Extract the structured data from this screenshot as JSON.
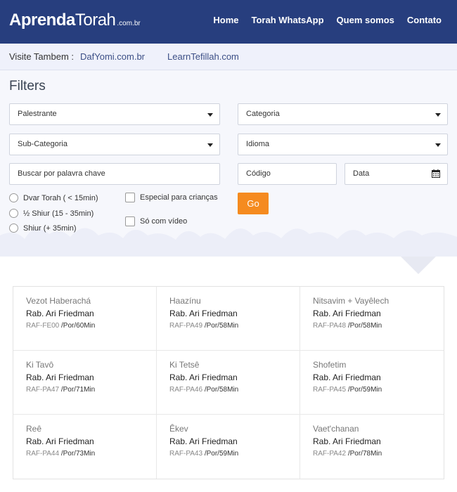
{
  "header": {
    "logo_aprenda": "Aprenda",
    "logo_torah": "Torah",
    "logo_domain": ".com.br",
    "nav": [
      "Home",
      "Torah WhatsApp",
      "Quem somos",
      "Contato"
    ]
  },
  "visit": {
    "label": "Visite Tambem :",
    "links": [
      "DafYomi.com.br",
      "LearnTefillah.com"
    ]
  },
  "filters": {
    "title": "Filters",
    "palestrante": "Palestrante",
    "categoria": "Categoria",
    "subcategoria": "Sub-Categoria",
    "idioma": "Idioma",
    "buscar_placeholder": "Buscar por palavra chave",
    "codigo_placeholder": "Código",
    "data_placeholder": "Data",
    "radios": [
      "Dvar Torah ( < 15min)",
      "½ Shiur (15 - 35min)",
      "Shiur (+ 35min)"
    ],
    "checks": [
      "Especial para crianças",
      "Só com vídeo"
    ],
    "go": "Go"
  },
  "results": [
    {
      "title": "Vezot Haberachá",
      "author": "Rab. Ari Friedman",
      "code": "RAF-FE00",
      "meta": " /Por/60Min"
    },
    {
      "title": "Haazínu",
      "author": "Rab. Ari Friedman",
      "code": "RAF-PA49",
      "meta": " /Por/58Min"
    },
    {
      "title": "Nitsavim + Vayêlech",
      "author": "Rab. Ari Friedman",
      "code": "RAF-PA48",
      "meta": " /Por/58Min"
    },
    {
      "title": "Ki Tavô",
      "author": "Rab. Ari Friedman",
      "code": "RAF-PA47",
      "meta": " /Por/71Min"
    },
    {
      "title": "Ki Tetsê",
      "author": "Rab. Ari Friedman",
      "code": "RAF-PA46",
      "meta": " /Por/58Min"
    },
    {
      "title": "Shofetim",
      "author": "Rab. Ari Friedman",
      "code": "RAF-PA45",
      "meta": " /Por/59Min"
    },
    {
      "title": "Reê",
      "author": "Rab. Ari Friedman",
      "code": "RAF-PA44",
      "meta": " /Por/73Min"
    },
    {
      "title": "Êkev",
      "author": "Rab. Ari Friedman",
      "code": "RAF-PA43",
      "meta": " /Por/59Min"
    },
    {
      "title": "Vaet'chanan",
      "author": "Rab. Ari Friedman",
      "code": "RAF-PA42",
      "meta": " /Por/78Min"
    }
  ],
  "colors": {
    "header_bg": "#273e7e",
    "go_button": "#f58b1f",
    "visit_bg": "#eff1fb"
  },
  "icons": [
    "caret-down-icon",
    "calendar-icon"
  ]
}
